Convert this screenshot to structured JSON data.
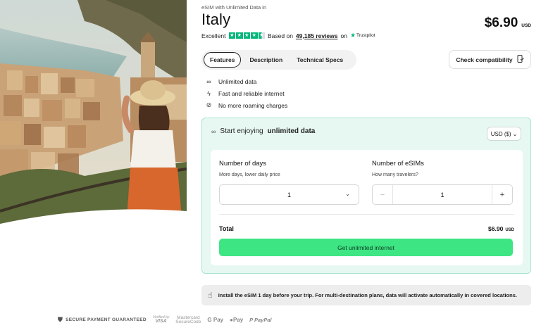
{
  "product": {
    "eyebrow": "eSIM with Unlimited Data in",
    "title": "Italy",
    "price": "$6.90",
    "currency": "USD"
  },
  "rating": {
    "label": "Excellent",
    "stars": 4.5,
    "based_on": "Based on",
    "count": "49,185 reviews",
    "on": "on",
    "source": "Trustpilot",
    "star_color": "#00b67a"
  },
  "tabs": [
    {
      "label": "Features",
      "active": true
    },
    {
      "label": "Description",
      "active": false
    },
    {
      "label": "Technical Specs",
      "active": false
    }
  ],
  "check_compatibility": {
    "label": "Check compatibility",
    "icon": "phone-check-icon"
  },
  "features": [
    {
      "icon": "infinity-icon",
      "label": "Unlimited data"
    },
    {
      "icon": "lightning-icon",
      "label": "Fast and reliable internet"
    },
    {
      "icon": "no-roaming-icon",
      "label": "No more roaming charges"
    }
  ],
  "card": {
    "heading_prefix": "Start enjoying",
    "heading_bold": "unlimited data",
    "currency_selector": "USD ($)",
    "days": {
      "label": "Number of days",
      "sub": "More days, lower daily price",
      "value": "1"
    },
    "esims": {
      "label": "Number of eSIMs",
      "sub": "How many travelers?",
      "value": "1",
      "minus": "−",
      "plus": "+"
    },
    "total_label": "Total",
    "total_value": "$6.90",
    "total_currency": "USD",
    "cta": "Get unlimited internet"
  },
  "notice": "Install the eSIM 1 day before your trip. For multi-destination plans, data will activate automatically in covered locations.",
  "payments": {
    "secure": "SECURE PAYMENT GUARANTEED",
    "visa_small": "Verified by",
    "visa": "VISA",
    "mastercard_1": "Mastercard",
    "mastercard_2": "SecureCode",
    "gpay": "G Pay",
    "applepay": "Pay",
    "paypal": "PayPal"
  },
  "colors": {
    "accent": "#3de583",
    "card_bg": "#e7f8f2",
    "card_border": "#a6e6cd"
  }
}
